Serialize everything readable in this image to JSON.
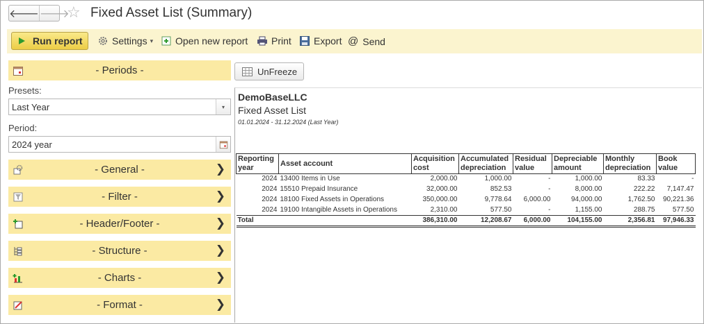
{
  "window": {
    "title": "Fixed Asset List (Summary)",
    "back_glyph": "🡐",
    "forward_glyph": "🡒",
    "favorite_glyph": "☆"
  },
  "toolbar": {
    "run_report": "Run report",
    "settings": "Settings",
    "open_new_report": "Open new report",
    "print": "Print",
    "export": "Export",
    "send": "Send",
    "send_glyph": "@",
    "dropdown_glyph": "▾"
  },
  "sidebar": {
    "periods_label": "- Periods -",
    "presets_label": "Presets:",
    "presets_value": "Last Year",
    "period_label": "Period:",
    "period_value": "2024 year",
    "chevron_glyph": "❯",
    "sections": [
      {
        "label": "- General -",
        "icon": "settings-gear-icon"
      },
      {
        "label": "- Filter -",
        "icon": "filter-icon"
      },
      {
        "label": "- Header/Footer -",
        "icon": "header-footer-icon"
      },
      {
        "label": "- Structure -",
        "icon": "structure-icon"
      },
      {
        "label": "- Charts -",
        "icon": "charts-icon"
      },
      {
        "label": "- Format -",
        "icon": "format-icon"
      }
    ]
  },
  "report": {
    "unfreeze_label": "UnFreeze",
    "company": "DemoBaseLLC",
    "title": "Fixed Asset List",
    "period": "01.01.2024 - 31.12.2024 (Last Year)",
    "headers": {
      "year": [
        "Reporting",
        "year"
      ],
      "account": "Asset account",
      "acq": [
        "Acquisition",
        "cost"
      ],
      "accum": [
        "Accumulated",
        "depreciation"
      ],
      "resid": [
        "Residual",
        "value"
      ],
      "deprec": [
        "Depreciable",
        "amount"
      ],
      "monthly": [
        "Monthly",
        "depreciation"
      ],
      "book": [
        "Book",
        "value"
      ]
    },
    "rows": [
      {
        "year": "2024",
        "account": "13400 Items in Use",
        "acq": "2,000.00",
        "accum": "1,000.00",
        "resid": "-",
        "deprec": "1,000.00",
        "monthly": "83.33",
        "book": "-"
      },
      {
        "year": "2024",
        "account": "15510 Prepaid Insurance",
        "acq": "32,000.00",
        "accum": "852.53",
        "resid": "-",
        "deprec": "8,000.00",
        "monthly": "222.22",
        "book": "7,147.47"
      },
      {
        "year": "2024",
        "account": "18100 Fixed Assets in Operations",
        "acq": "350,000.00",
        "accum": "9,778.64",
        "resid": "6,000.00",
        "deprec": "94,000.00",
        "monthly": "1,762.50",
        "book": "90,221.36"
      },
      {
        "year": "2024",
        "account": "19100 Intangible Assets in Operations",
        "acq": "2,310.00",
        "accum": "577.50",
        "resid": "-",
        "deprec": "1,155.00",
        "monthly": "288.75",
        "book": "577.50"
      }
    ],
    "total": {
      "label": "Total",
      "acq": "386,310.00",
      "accum": "12,208.67",
      "resid": "6,000.00",
      "deprec": "104,155.00",
      "monthly": "2,356.81",
      "book": "97,946.33"
    }
  },
  "colors": {
    "command_bar_bg": "#fbf4cf",
    "section_bar_bg": "#fbeaa3",
    "run_button": "#eccd46",
    "run_icon": "#2e9a2e"
  }
}
